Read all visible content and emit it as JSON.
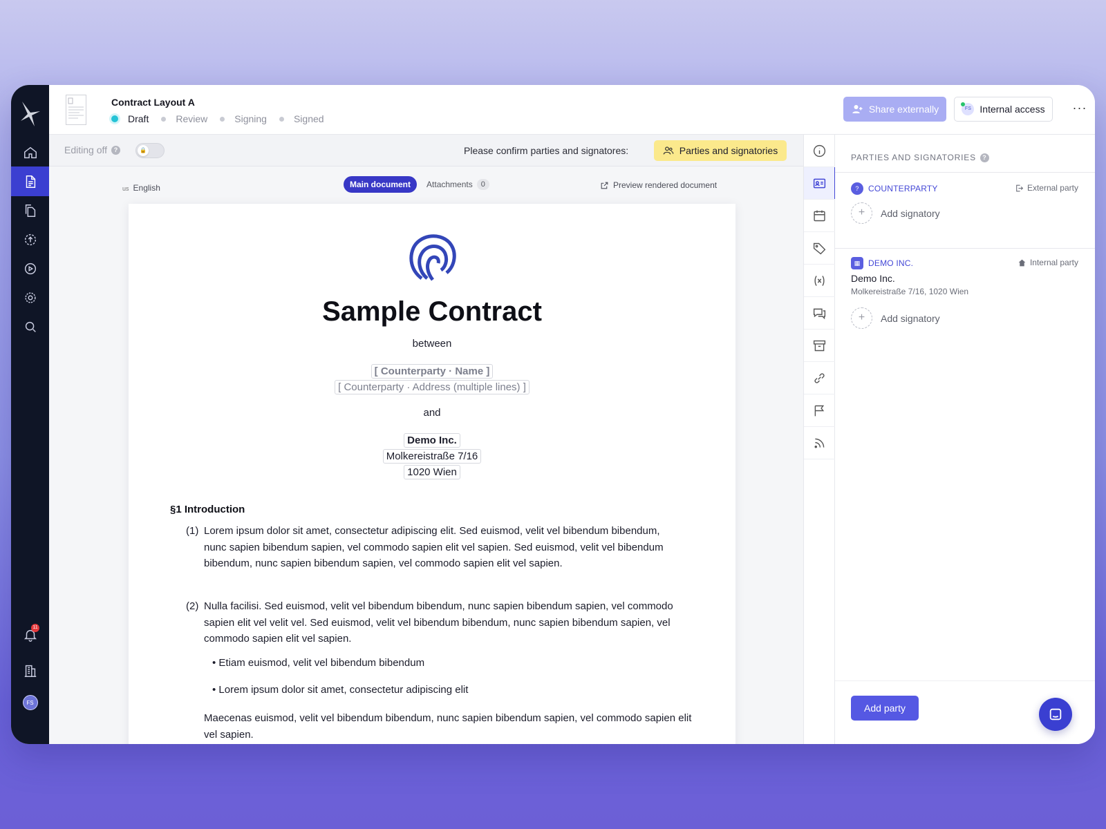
{
  "header": {
    "doc_title": "Contract Layout A",
    "steps": [
      "Draft",
      "Review",
      "Signing",
      "Signed"
    ],
    "share_label": "Share externally",
    "internal_label": "Internal access",
    "avatar_initials": "FS",
    "more_label": "···"
  },
  "nav": {
    "notification_count": "11",
    "avatar_initials": "FS"
  },
  "toolbar": {
    "editing_label": "Editing off",
    "confirm_text": "Please confirm parties and signatores:",
    "parties_button": "Parties and signatories"
  },
  "doc_controls": {
    "lang_code": "us",
    "language": "English",
    "tab_main": "Main document",
    "tab_attachments": "Attachments",
    "attachments_count": "0",
    "preview_label": "Preview rendered document"
  },
  "document": {
    "title": "Sample Contract",
    "between": "between",
    "counterparty_name": "[ Counterparty · Name ]",
    "counterparty_address": "[ Counterparty · Address (multiple lines) ]",
    "and": "and",
    "party_name": "Demo Inc.",
    "party_street": "Molkereistraße 7/16",
    "party_city": "1020 Wien",
    "section1_title": "§1 Introduction",
    "p1_num": "(1)",
    "p1_text": "Lorem ipsum dolor sit amet, consectetur adipiscing elit. Sed euismod, velit vel bibendum bibendum, nunc sapien bibendum sapien, vel commodo sapien elit vel sapien. Sed euismod, velit vel bibendum bibendum, nunc sapien bibendum sapien, vel commodo sapien elit vel sapien.",
    "p2_num": "(2)",
    "p2_text": "Nulla facilisi. Sed euismod, velit vel bibendum bibendum, nunc sapien bibendum sapien, vel commodo sapien elit vel  velit vel. Sed euismod, velit vel bibendum bibendum, nunc sapien bibendum sapien, vel commodo sapien elit vel sapien.",
    "bullet1": "• Etiam euismod, velit vel bibendum bibendum",
    "bullet2": "• Lorem ipsum dolor sit amet, consectetur adipiscing elit",
    "p3_text": "Maecenas euismod, velit vel bibendum bibendum, nunc sapien bibendum sapien, vel commodo sapien elit vel sapien."
  },
  "panel": {
    "title": "PARTIES AND SIGNATORIES",
    "counterparty_label": "COUNTERPARTY",
    "counterparty_type": "External party",
    "add_signatory": "Add signatory",
    "demo_label": "DEMO INC.",
    "demo_type": "Internal party",
    "demo_name": "Demo Inc.",
    "demo_address": "Molkereistraße 7/16, 1020 Wien",
    "add_party": "Add party"
  },
  "colors": {
    "accent": "#3b3fd1",
    "nav_bg": "#0f1526",
    "highlight_pill": "#fbe98c",
    "status_draft": "#25c3d6"
  }
}
